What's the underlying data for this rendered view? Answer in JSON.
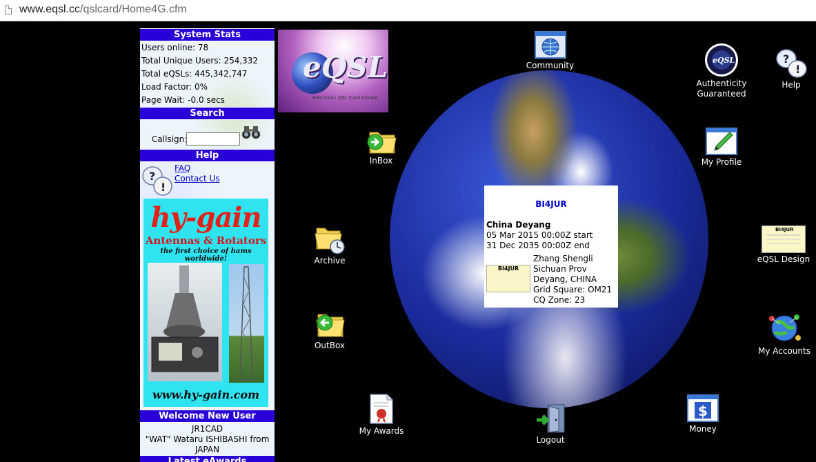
{
  "browser": {
    "url_host": "www.eqsl.cc",
    "url_path": "/qslcard/Home4G.cfm"
  },
  "stats": {
    "header": "System Stats",
    "lines": [
      "Users online: 78",
      "Total Unique Users: 254,332",
      "Total eQSLs: 445,342,747",
      "Load Factor: 0%",
      "Page Wait: -0.0 secs"
    ]
  },
  "search": {
    "header": "Search",
    "callsign_label": "Callsign:",
    "callsign_value": ""
  },
  "help": {
    "header": "Help",
    "links": [
      "FAQ",
      "Contact Us"
    ]
  },
  "ad": {
    "brand": "hy-gain",
    "line1": "Antennas & Rotators",
    "line2": "the first choice of hams worldwide!",
    "site": "www.hy-gain.com"
  },
  "welcome": {
    "header": "Welcome New User",
    "call": "JR1CAD",
    "name": "\"WAT\" Wataru ISHIBASHI from",
    "country": "JAPAN",
    "next_header": "Latest eAwards"
  },
  "logo": {
    "text": "eQSL",
    "caption": "Electronic QSL Card Centre"
  },
  "nav": {
    "community": "Community",
    "authenticity_line1": "Authenticity",
    "authenticity_line2": "Guaranteed",
    "help": "Help",
    "inbox": "InBox",
    "my_profile": "My Profile",
    "archive": "Archive",
    "eqsl_design": "eQSL Design",
    "outbox": "OutBox",
    "my_accounts": "My Accounts",
    "my_awards": "My Awards",
    "logout": "Logout",
    "money": "Money"
  },
  "account": {
    "callsign": "BI4JUR",
    "location": "China Deyang",
    "start": "05 Mar 2015 00:00Z start",
    "end": "31 Dec 2035 00:00Z end",
    "name": "Zhang Shengli",
    "province": "Sichuan Prov",
    "city": "Deyang, CHINA",
    "grid": "Grid Square: OM21",
    "cq": "CQ Zone: 23"
  },
  "colors": {
    "header_bar": "#2a00d8",
    "link": "#0000cc",
    "background": "#000000"
  }
}
